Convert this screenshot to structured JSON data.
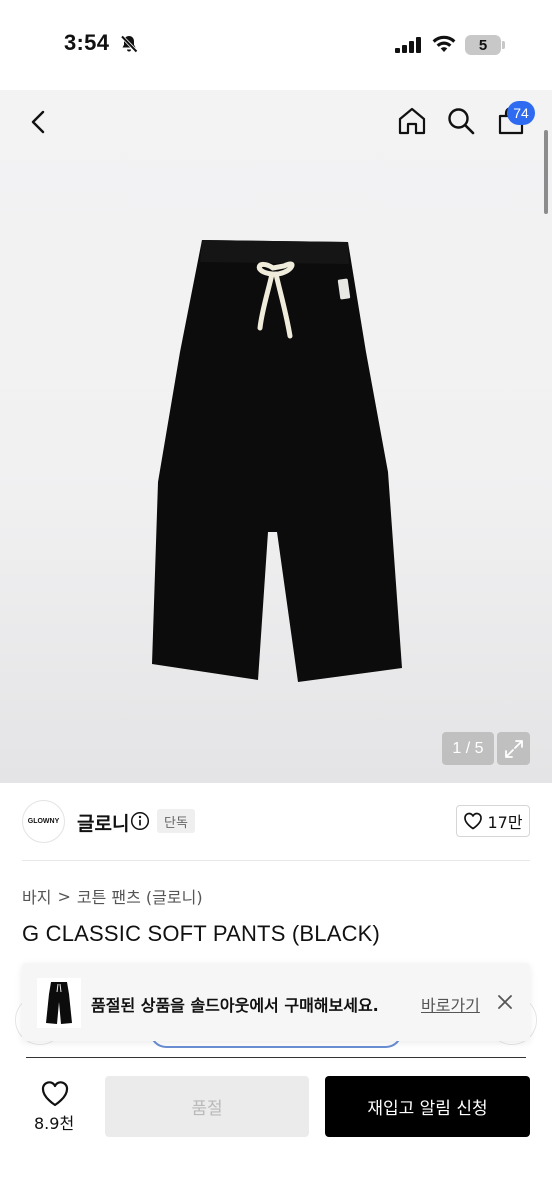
{
  "status_bar": {
    "time": "3:54",
    "battery": "5"
  },
  "nav": {
    "cart_count": "74"
  },
  "gallery": {
    "counter": "1 / 5"
  },
  "brand": {
    "logo_text": "GLOWNY",
    "name": "글로니",
    "badge": "단독",
    "likes": "17만"
  },
  "breadcrumb": {
    "level1": "바지",
    "separator": ">",
    "level2": "코튼 팬츠 (글로니)"
  },
  "product": {
    "title": "G CLASSIC SOFT PANTS (BLACK)"
  },
  "toast": {
    "message": "품절된 상품을 솔드아웃에서 구매해보세요.",
    "link": "바로가기"
  },
  "bottom_bar": {
    "wish_count": "8.9천",
    "soldout_label": "품절",
    "restock_label": "재입고 알림 신청"
  },
  "colors": {
    "accent_blue": "#2f6bf0",
    "primary_black": "#000000",
    "disabled_gray": "#ebebeb"
  }
}
